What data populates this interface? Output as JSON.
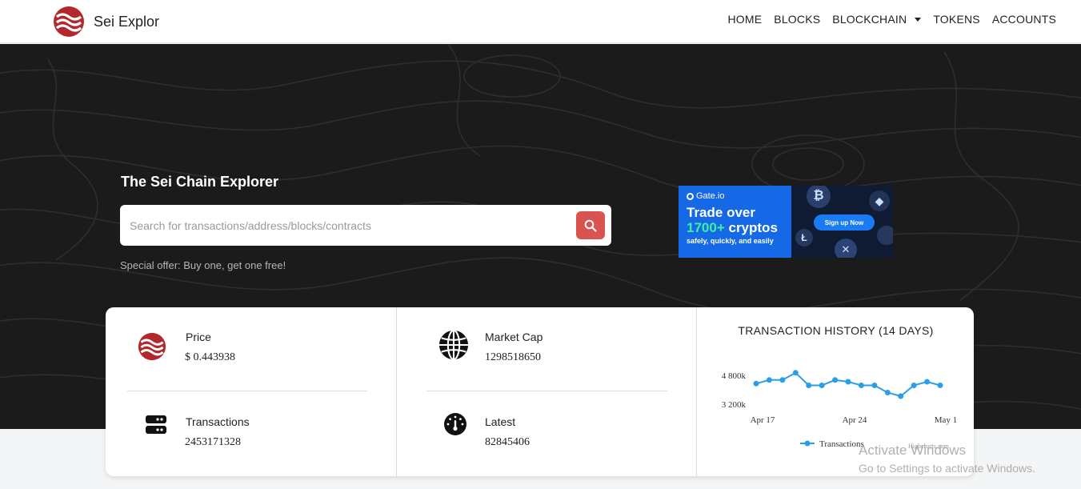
{
  "brand": {
    "name": "Sei Explor",
    "logo_icon": "sei-logo-icon",
    "color": "#b3282d"
  },
  "nav": {
    "items": [
      {
        "label": "HOME"
      },
      {
        "label": "BLOCKS"
      },
      {
        "label": "BLOCKCHAIN",
        "dropdown": true
      },
      {
        "label": "TOKENS"
      },
      {
        "label": "ACCOUNTS"
      }
    ]
  },
  "hero": {
    "title": "The Sei Chain Explorer",
    "search_placeholder": "Search for transactions/address/blocks/contracts",
    "search_icon": "search-icon",
    "search_button_color": "#d9534f",
    "offer_text": "Special offer: Buy one, get one free!"
  },
  "ad": {
    "brand": "Gate.io",
    "line1": "Trade over",
    "line2_number": "1700+",
    "line2_word": "cryptos",
    "line3": "safely, quickly, and easily",
    "cta": "Sign up Now"
  },
  "stats": {
    "price": {
      "label": "Price",
      "value": "$ 0.443938",
      "icon": "sei-logo-icon"
    },
    "transactions": {
      "label": "Transactions",
      "value": "2453171328",
      "icon": "server-icon"
    },
    "market_cap": {
      "label": "Market Cap",
      "value": "1298518650",
      "icon": "globe-icon"
    },
    "latest": {
      "label": "Latest",
      "value": "82845406",
      "icon": "speedometer-icon"
    }
  },
  "chart_title": "TRANSACTION HISTORY (14 DAYS)",
  "chart_data": {
    "type": "line",
    "series": [
      {
        "name": "Transactions",
        "values": [
          4300,
          4500,
          4500,
          4900,
          4200,
          4200,
          4500,
          4400,
          4200,
          4200,
          3800,
          3600,
          4200,
          4400,
          4200
        ]
      }
    ],
    "x_ticks": [
      "Apr 17",
      "Apr 24",
      "May 1"
    ],
    "y_ticks": [
      "4 800k",
      "3 200k"
    ],
    "ylim": [
      2800,
      5200
    ],
    "line_color": "#2b9fe6",
    "credit": "Highcharts.com"
  },
  "watermark": {
    "line1": "Activate Windows",
    "line2": "Go to Settings to activate Windows."
  }
}
